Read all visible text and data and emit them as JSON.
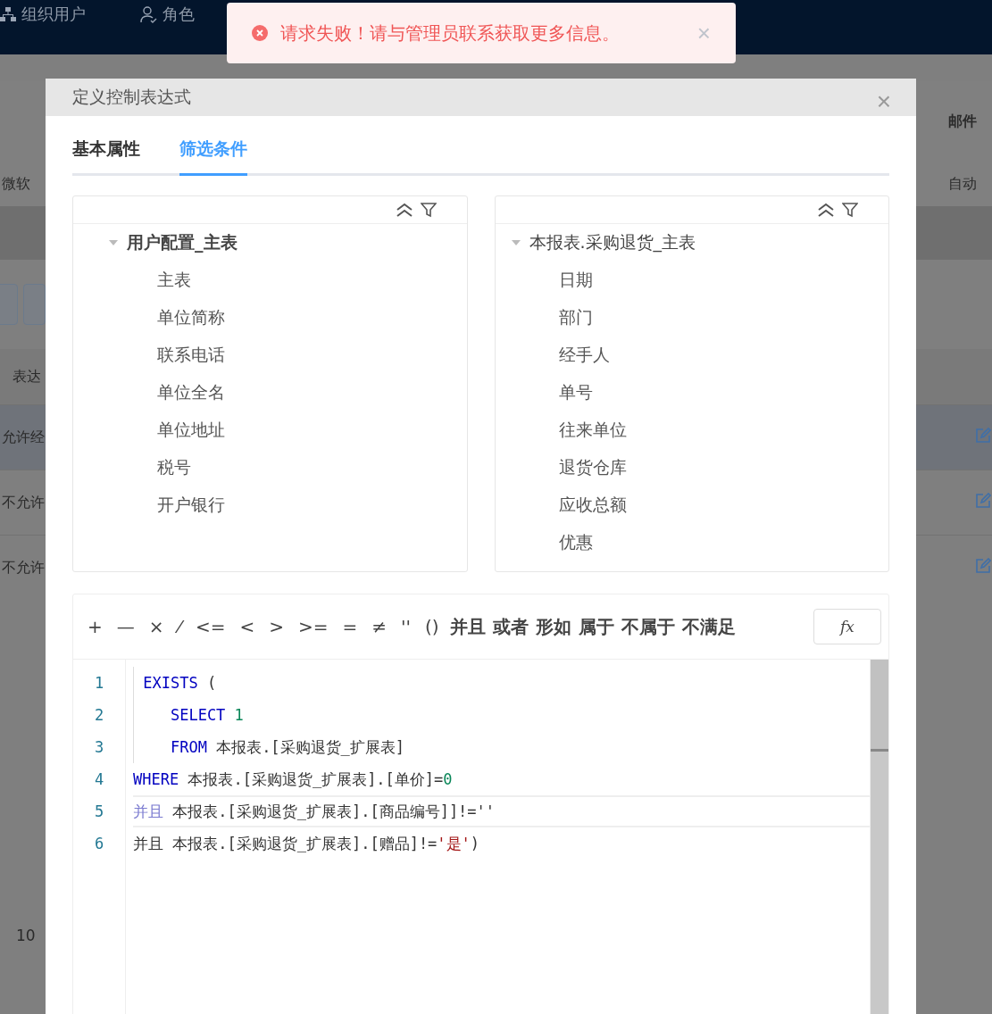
{
  "page": {
    "nav": [
      {
        "label": "组织用户"
      },
      {
        "label": "角色"
      }
    ],
    "header_row": {
      "right": "邮件"
    },
    "first_row": {
      "left": "微软",
      "right": "自动"
    },
    "column_header": {
      "left": "表达"
    },
    "rows": [
      {
        "left": "允许经",
        "selected": true
      },
      {
        "left": "不允许",
        "selected": false
      },
      {
        "left": "不允许",
        "selected": false
      }
    ],
    "pager": "10"
  },
  "toast": {
    "message": "请求失败！请与管理员联系获取更多信息。",
    "close": "×"
  },
  "dialog": {
    "title": "定义控制表达式",
    "close": "×",
    "tabs": [
      {
        "label": "基本属性",
        "selected": false
      },
      {
        "label": "筛选条件",
        "selected": true
      }
    ],
    "trees": [
      {
        "root": {
          "label": "用户配置_主表",
          "expanded": true,
          "bold": true,
          "children": [
            {
              "label": "主表"
            },
            {
              "label": "单位简称"
            },
            {
              "label": "联系电话"
            },
            {
              "label": "单位全名"
            },
            {
              "label": "单位地址"
            },
            {
              "label": "税号"
            },
            {
              "label": "开户银行"
            }
          ]
        }
      },
      {
        "root": {
          "label": "本报表.采购退货_主表",
          "expanded": true,
          "bold": false,
          "children": [
            {
              "label": "日期"
            },
            {
              "label": "部门"
            },
            {
              "label": "经手人"
            },
            {
              "label": "单号"
            },
            {
              "label": "往来单位"
            },
            {
              "label": "退货仓库"
            },
            {
              "label": "应收总额"
            },
            {
              "label": "优惠"
            }
          ]
        }
      }
    ],
    "operators": [
      "+",
      "—",
      "×",
      "⁄",
      "<=",
      "<",
      ">",
      ">=",
      "=",
      "≠",
      "''",
      "()",
      "并且",
      "或者",
      "形如",
      "属于",
      "不属于",
      "不满足"
    ],
    "fx": "fx",
    "code": [
      {
        "number": "1",
        "current": false,
        "guide": true,
        "tokens": [
          {
            "kind": "keyword",
            "text": " EXISTS"
          },
          {
            "kind": "text",
            "text": " ("
          }
        ]
      },
      {
        "number": "2",
        "current": false,
        "guide": true,
        "tokens": [
          {
            "kind": "keyword",
            "text": "    SELECT "
          },
          {
            "kind": "number",
            "text": "1"
          }
        ]
      },
      {
        "number": "3",
        "current": false,
        "guide": true,
        "tokens": [
          {
            "kind": "keyword",
            "text": "    FROM"
          },
          {
            "kind": "text",
            "text": " 本报表.[采购退货_扩展表]"
          }
        ]
      },
      {
        "number": "4",
        "current": false,
        "guide": false,
        "tokens": [
          {
            "kind": "keyword",
            "text": "WHERE"
          },
          {
            "kind": "text",
            "text": " 本报表.[采购退货_扩展表].[单价]="
          },
          {
            "kind": "number",
            "text": "0"
          }
        ]
      },
      {
        "number": "5",
        "current": true,
        "guide": false,
        "tokens": [
          {
            "kind": "operator",
            "text": "并且"
          },
          {
            "kind": "text",
            "text": " 本报表.[采购退货_扩展表].[商品编号]]!=''"
          }
        ]
      },
      {
        "number": "6",
        "current": false,
        "guide": false,
        "tokens": [
          {
            "kind": "text",
            "text": "并且 本报表.[采购退货_扩展表].[赠品]!="
          },
          {
            "kind": "string",
            "text": "'是'"
          },
          {
            "kind": "text",
            "text": ")"
          }
        ]
      }
    ]
  }
}
